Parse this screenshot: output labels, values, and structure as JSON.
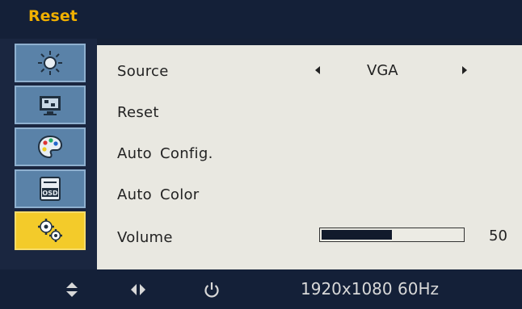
{
  "header": {
    "title": "Reset"
  },
  "sidebar": {
    "items": [
      {
        "name": "brightness",
        "icon": "sun-icon"
      },
      {
        "name": "image",
        "icon": "monitor-icon"
      },
      {
        "name": "color",
        "icon": "palette-icon"
      },
      {
        "name": "osd",
        "icon": "osd-icon",
        "badge": "OSD"
      },
      {
        "name": "reset",
        "icon": "gears-icon",
        "active": true
      }
    ]
  },
  "main": {
    "source": {
      "label": "Source",
      "value": "VGA"
    },
    "reset": {
      "label": "Reset"
    },
    "auto_config": {
      "label": "Auto Config."
    },
    "auto_color": {
      "label": "Auto Color"
    },
    "volume": {
      "label": "Volume",
      "value": "50",
      "level_percent": 50
    }
  },
  "footer": {
    "icons": [
      "up-down-arrows-icon",
      "left-right-arrows-icon",
      "power-icon"
    ],
    "resolution": "1920x1080 60Hz"
  },
  "colors": {
    "accent": "#f0b000",
    "active_tab": "#f3cb2a",
    "sidebar_tab": "#5a82a8",
    "panel": "#e9e8e1",
    "chrome": "#142038"
  }
}
